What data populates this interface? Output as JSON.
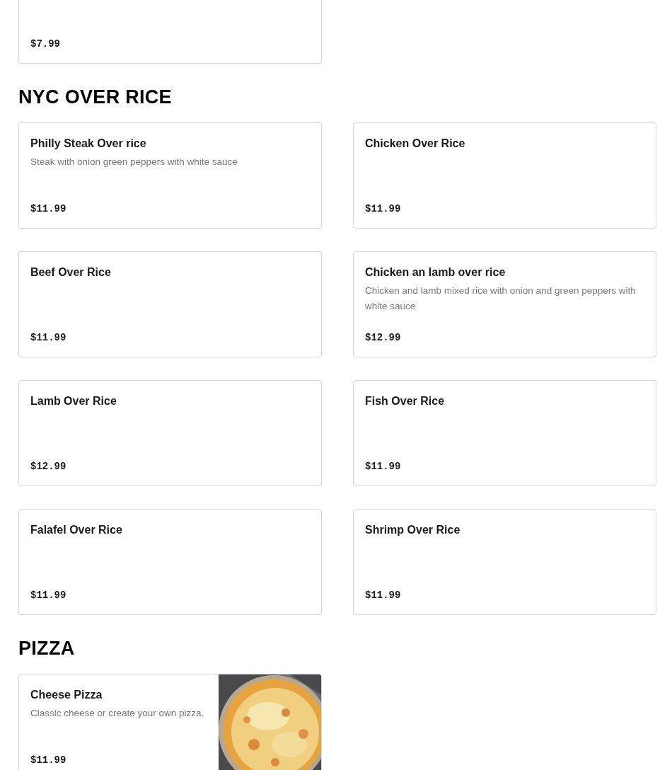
{
  "top_card": {
    "price": "$7.99"
  },
  "sections": [
    {
      "title": "NYC OVER RICE",
      "items": [
        {
          "name": "Philly Steak Over rice",
          "description": "Steak with onion green peppers with white sauce",
          "price": "$11.99"
        },
        {
          "name": "Chicken Over Rice",
          "price": "$11.99"
        },
        {
          "name": "Beef Over Rice",
          "price": "$11.99"
        },
        {
          "name": "Chicken an lamb over rice",
          "description": "Chicken and lamb mixed rice with onion and green peppers with white sauce",
          "price": "$12.99"
        },
        {
          "name": "Lamb Over Rice",
          "price": "$12.99"
        },
        {
          "name": "Fish Over Rice",
          "price": "$11.99"
        },
        {
          "name": "Falafel Over Rice",
          "price": "$11.99"
        },
        {
          "name": "Shrimp Over Rice",
          "price": "$11.99"
        }
      ]
    },
    {
      "title": "PIZZA",
      "items": [
        {
          "name": "Cheese Pizza",
          "description": "Classic cheese or create your own pizza.",
          "price": "$11.99",
          "kind": "picture"
        }
      ]
    }
  ]
}
